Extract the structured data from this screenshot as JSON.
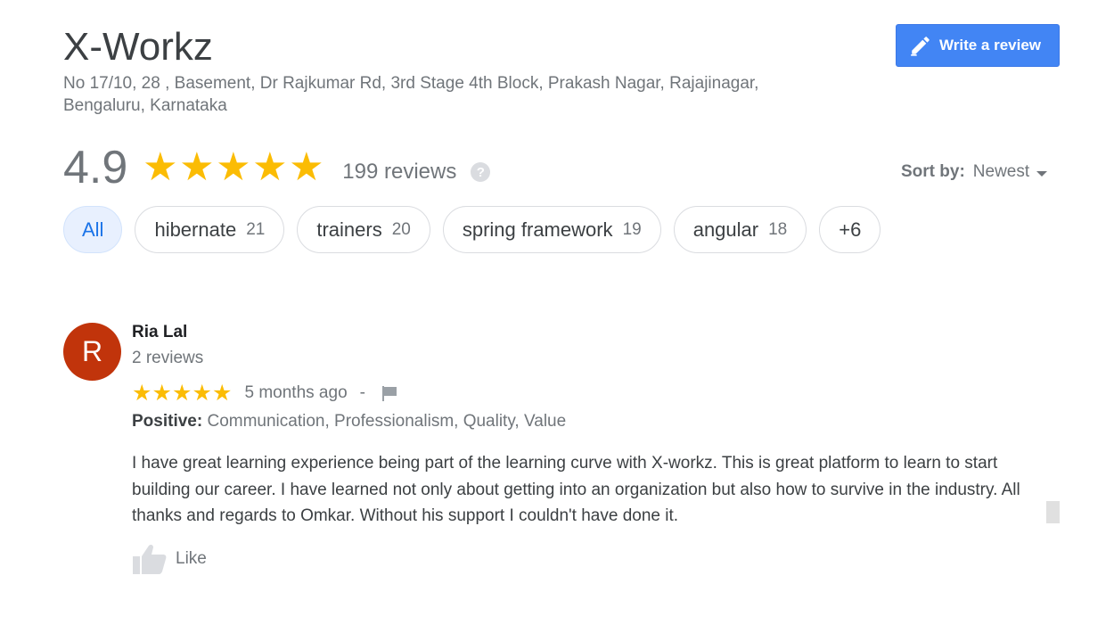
{
  "business": {
    "name": "X-Workz",
    "address": "No 17/10, 28 , Basement, Dr Rajkumar Rd, 3rd Stage 4th Block, Prakash Nagar, Rajajinagar, Bengaluru, Karnataka"
  },
  "write_review_button": {
    "label": "Write a review",
    "icon": "pencil-icon"
  },
  "rating": {
    "value": "4.9",
    "stars": 5,
    "reviews_label": "199 reviews",
    "help_icon": "?"
  },
  "sort": {
    "label": "Sort by:",
    "value": "Newest"
  },
  "filter_chips": [
    {
      "label": "All",
      "count": "",
      "active": true
    },
    {
      "label": "hibernate",
      "count": "21"
    },
    {
      "label": "trainers",
      "count": "20"
    },
    {
      "label": "spring framework",
      "count": "19"
    },
    {
      "label": "angular",
      "count": "18"
    },
    {
      "label": "+6",
      "count": ""
    }
  ],
  "review": {
    "avatar_letter": "R",
    "reviewer_name": "Ria Lal",
    "reviewer_reviews": "2 reviews",
    "stars": 5,
    "time": "5 months ago",
    "separator": "-",
    "positive_label": "Positive:",
    "positive_values": "Communication, Professionalism, Quality, Value",
    "text": "I have great learning experience being part of the learning curve with X-workz. This is great platform to learn to start building our career. I have learned not only about getting into an organization but also how to survive in the industry. All thanks and regards to Omkar. Without his support I couldn't have done it.",
    "like_label": "Like"
  },
  "colors": {
    "star": "#fbbc04",
    "accent_button": "#4285f4",
    "avatar_bg": "#c1340b",
    "chip_active_bg": "#e8f0fe",
    "chip_active_text": "#1a73e8"
  }
}
